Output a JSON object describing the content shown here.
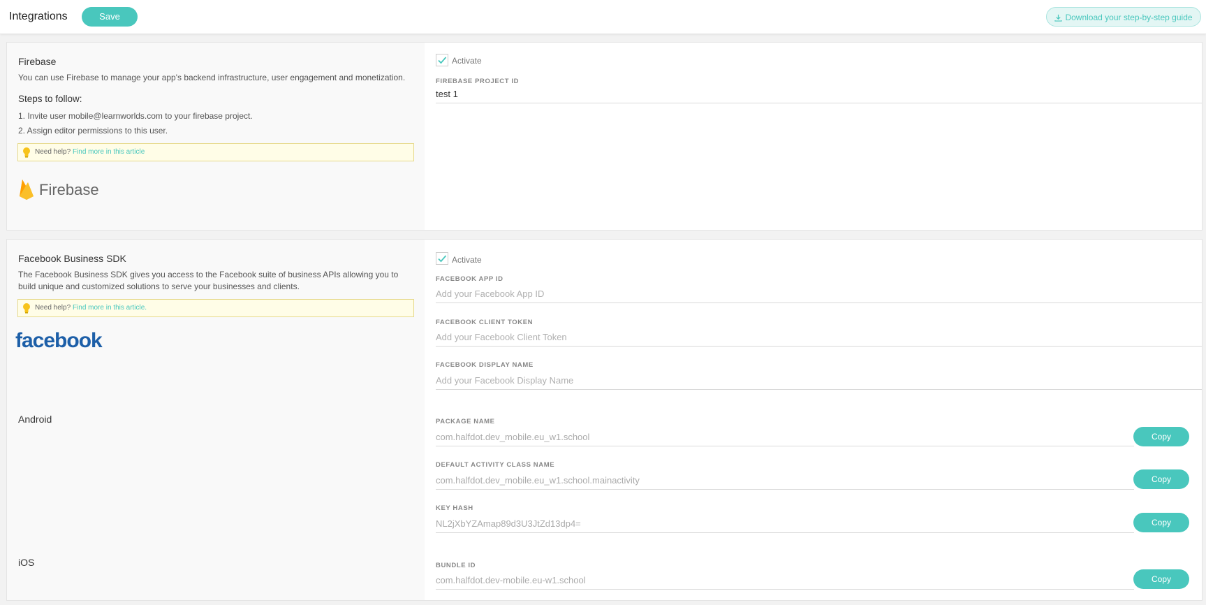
{
  "header": {
    "title": "Integrations",
    "save_label": "Save",
    "guide_label": "Download your step-by-step guide"
  },
  "firebase": {
    "title": "Firebase",
    "description": "You can use Firebase to manage your app's backend infrastructure, user engagement and monetization.",
    "steps_title": "Steps to follow:",
    "steps": [
      "1. Invite user mobile@learnworlds.com to your firebase project.",
      "2. Assign editor permissions to this user."
    ],
    "help_prefix": "Need help?",
    "help_link": "Find more in this article",
    "logo_text": "Firebase",
    "activate_label": "Activate",
    "activate_checked": true,
    "project_id_label": "FIREBASE PROJECT ID",
    "project_id_value": "test 1"
  },
  "facebook": {
    "title": "Facebook Business SDK",
    "description": "The Facebook Business SDK gives you access to the Facebook suite of business APIs allowing you to build unique and customized solutions to serve your businesses and clients.",
    "help_prefix": "Need help?",
    "help_link": "Find more in this article.",
    "logo_text": "facebook",
    "activate_label": "Activate",
    "activate_checked": true,
    "app_id_label": "FACEBOOK APP ID",
    "app_id_placeholder": "Add your Facebook App ID",
    "client_token_label": "FACEBOOK CLIENT TOKEN",
    "client_token_placeholder": "Add your Facebook Client Token",
    "display_name_label": "FACEBOOK DISPLAY NAME",
    "display_name_placeholder": "Add your Facebook Display Name"
  },
  "android": {
    "title": "Android",
    "package_label": "PACKAGE NAME",
    "package_value": "com.halfdot.dev_mobile.eu_w1.school",
    "activity_label": "DEFAULT ACTIVITY CLASS NAME",
    "activity_value": "com.halfdot.dev_mobile.eu_w1.school.mainactivity",
    "keyhash_label": "KEY HASH",
    "keyhash_value": "NL2jXbYZAmap89d3U3JtZd13dp4="
  },
  "ios": {
    "title": "iOS",
    "bundle_label": "BUNDLE ID",
    "bundle_value": "com.halfdot.dev-mobile.eu-w1.school"
  },
  "copy_label": "Copy",
  "colors": {
    "accent": "#49c7bd",
    "firebase_yellow": "#f6b819",
    "facebook_blue": "#1d5fa8",
    "help_bg": "#fffde7"
  }
}
